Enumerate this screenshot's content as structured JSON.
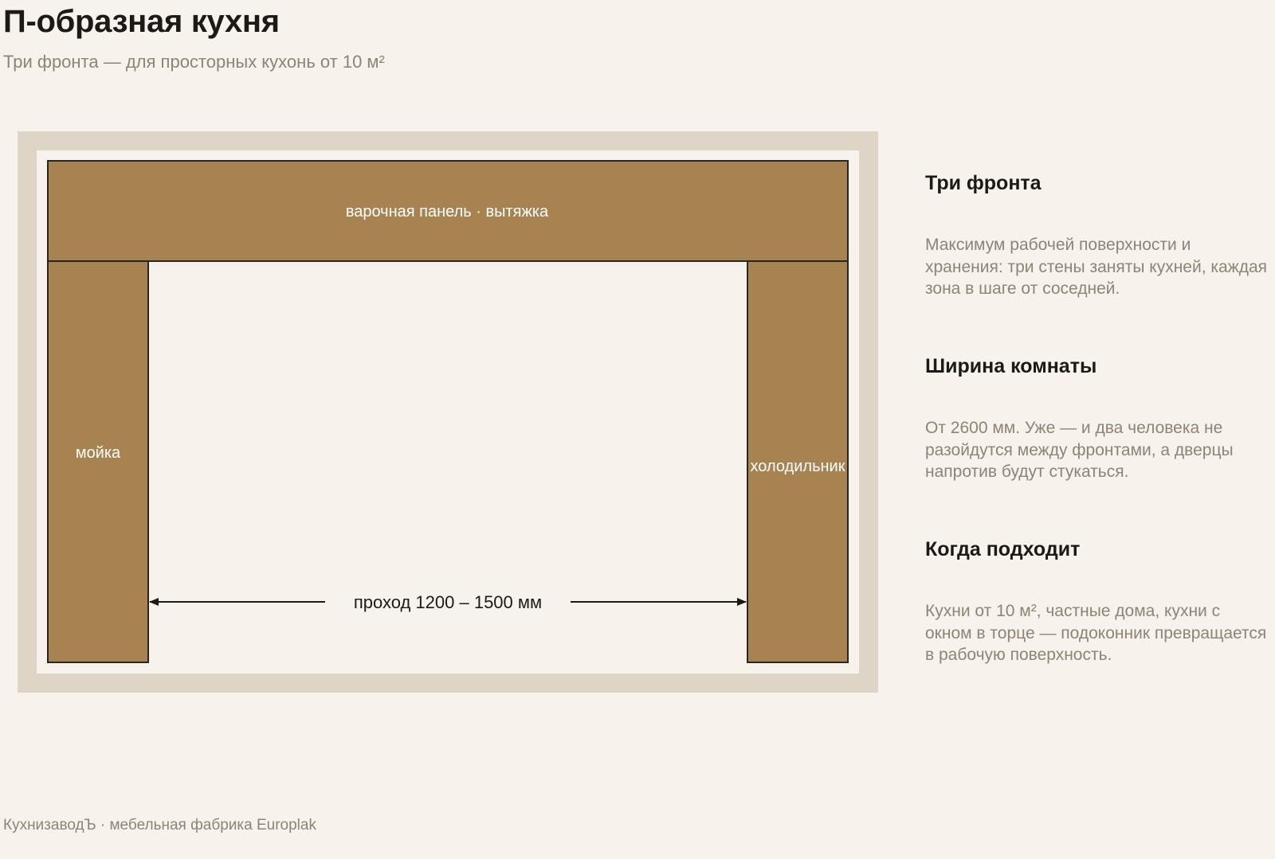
{
  "header": {
    "title": "П-образная кухня",
    "subtitle": "Три фронта — для просторных кухонь от 10 м²"
  },
  "plan": {
    "top_counter_label": "варочная панель · вытяжка",
    "left_counter_label": "мойка",
    "right_counter_label": "холодильник",
    "aisle_label": "проход 1200 – 1500 мм"
  },
  "info": {
    "sections": [
      {
        "heading": "Три фронта",
        "text": "Максимум рабочей поверхности и хранения: три стены заняты кухней, каждая зона в шаге от соседней."
      },
      {
        "heading": "Ширина комнаты",
        "text": "От 2600 мм. Уже — и два человека не разойдутся между фронтами, а дверцы напротив будут стукаться."
      },
      {
        "heading": "Когда подходит",
        "text": "Кухни от 10 м², частные дома, кухни с окном в торце — подоконник превращается в рабочую поверхность."
      }
    ]
  },
  "footer": {
    "text": "КухнизаводЪ · мебельная фабрика Europlak"
  },
  "colors": {
    "background": "#f7f2ec",
    "wall": "#ded5c6",
    "floor": "#f7f2ec",
    "counter": "#a88352",
    "outline": "#2a2520",
    "heading": "#1c1a17",
    "muted_text": "#8d8478"
  }
}
